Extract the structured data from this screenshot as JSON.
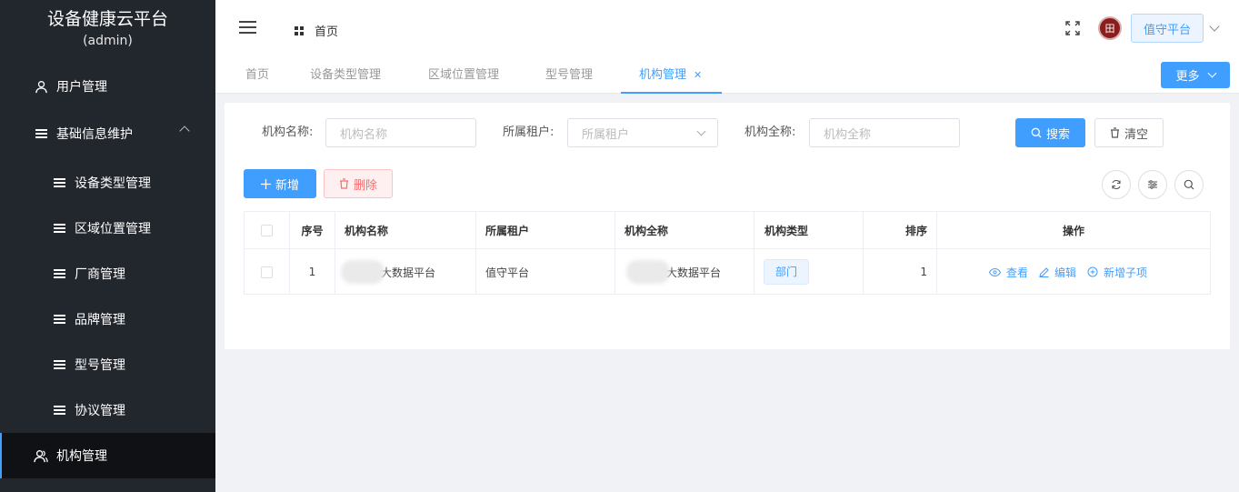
{
  "brand": {
    "title": "设备健康云平台",
    "user": "(admin)"
  },
  "sidebar": {
    "items": [
      {
        "label": "用户管理"
      },
      {
        "label": "基础信息维护"
      },
      {
        "label": "设备类型管理"
      },
      {
        "label": "区域位置管理"
      },
      {
        "label": "厂商管理"
      },
      {
        "label": "品牌管理"
      },
      {
        "label": "型号管理"
      },
      {
        "label": "协议管理"
      },
      {
        "label": "机构管理"
      }
    ]
  },
  "header": {
    "breadcrumb": "首页",
    "platform": "值守平台",
    "avatar_text": "田"
  },
  "tabs": {
    "items": [
      {
        "label": "首页"
      },
      {
        "label": "设备类型管理"
      },
      {
        "label": "区域位置管理"
      },
      {
        "label": "型号管理"
      },
      {
        "label": "机构管理"
      }
    ],
    "more": "更多"
  },
  "search": {
    "org_name_label": "机构名称:",
    "org_name_placeholder": "机构名称",
    "tenant_label": "所属租户:",
    "tenant_placeholder": "所属租户",
    "full_name_label": "机构全称:",
    "full_name_placeholder": "机构全称",
    "search_btn": "搜索",
    "clear_btn": "清空"
  },
  "toolbar": {
    "add": "新增",
    "delete": "删除"
  },
  "table": {
    "headers": {
      "index": "序号",
      "name": "机构名称",
      "tenant": "所属租户",
      "full_name": "机构全称",
      "type": "机构类型",
      "sort": "排序",
      "actions": "操作"
    },
    "rows": [
      {
        "index": "1",
        "name": "大数据平台",
        "tenant": "值守平台",
        "full_name": "大数据平台",
        "type": "部门",
        "sort": "1"
      }
    ],
    "actions": {
      "view": "查看",
      "edit": "编辑",
      "add_child": "新增子项"
    }
  },
  "colors": {
    "primary": "#409eff",
    "sidebar_bg": "#22262d",
    "danger": "#f56c6c"
  }
}
